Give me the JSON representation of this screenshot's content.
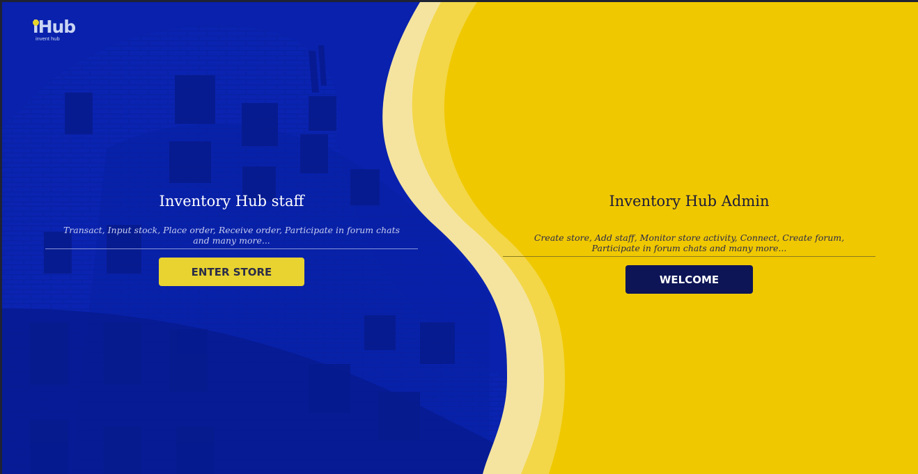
{
  "brand": {
    "logo_text": "iHub",
    "tagline": "invent hub"
  },
  "staff_panel": {
    "title": "Inventory Hub staff",
    "description": "Transact, Input stock, Place order, Receive order, Participate in forum chats and many more...",
    "button_label": "ENTER STORE"
  },
  "admin_panel": {
    "title": "Inventory Hub Admin",
    "description": "Create store, Add staff, Monitor store activity, Connect, Create forum, Participate in forum chats and many more...",
    "button_label": "WELCOME"
  },
  "colors": {
    "blue_panel": "#0a22a8",
    "yellow_panel": "#f0c800",
    "enter_button": "#e8d330",
    "welcome_button": "#0d1556"
  }
}
